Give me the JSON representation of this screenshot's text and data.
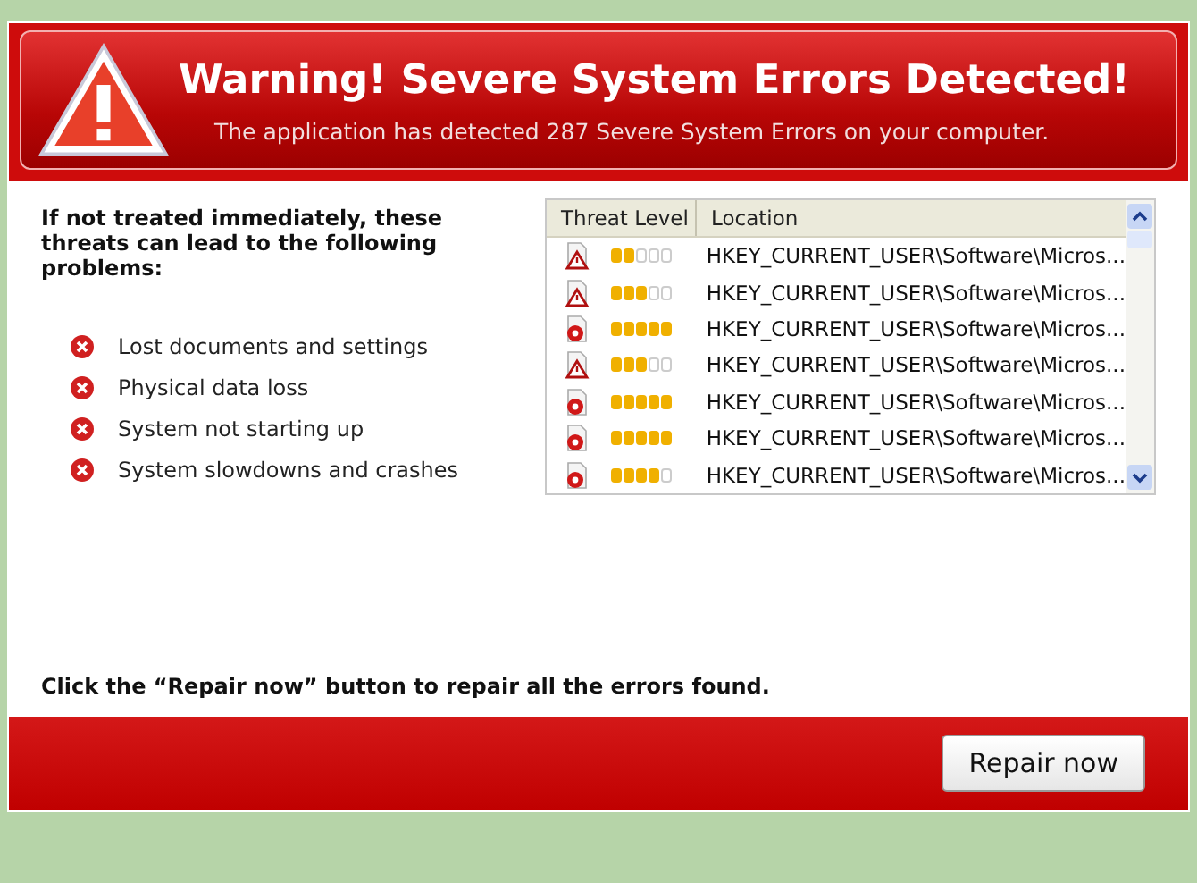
{
  "header": {
    "title": "Warning! Severe System Errors Detected!",
    "subtitle": "The application has detected 287 Severe System Errors on your computer."
  },
  "intro": "If not treated immediately, these threats can lead to the following problems:",
  "problems": [
    "Lost documents and settings",
    "Physical data loss",
    "System not starting up",
    "System slowdowns and crashes"
  ],
  "table": {
    "columns": [
      "Threat Level",
      "Location"
    ],
    "rows": [
      {
        "kind": "warning",
        "stars": 2,
        "location": "HKEY_CURRENT_USER\\Software\\Micros..."
      },
      {
        "kind": "warning",
        "stars": 3,
        "location": "HKEY_CURRENT_USER\\Software\\Micros..."
      },
      {
        "kind": "error",
        "stars": 5,
        "location": "HKEY_CURRENT_USER\\Software\\Micros..."
      },
      {
        "kind": "warning",
        "stars": 3,
        "location": "HKEY_CURRENT_USER\\Software\\Micros..."
      },
      {
        "kind": "error",
        "stars": 5,
        "location": "HKEY_CURRENT_USER\\Software\\Micros..."
      },
      {
        "kind": "error",
        "stars": 5,
        "location": "HKEY_CURRENT_USER\\Software\\Micros..."
      },
      {
        "kind": "error",
        "stars": 4,
        "location": "HKEY_CURRENT_USER\\Software\\Micros..."
      }
    ]
  },
  "instruction": "Click the “Repair now” button to repair all the errors found.",
  "button": "Repair now"
}
